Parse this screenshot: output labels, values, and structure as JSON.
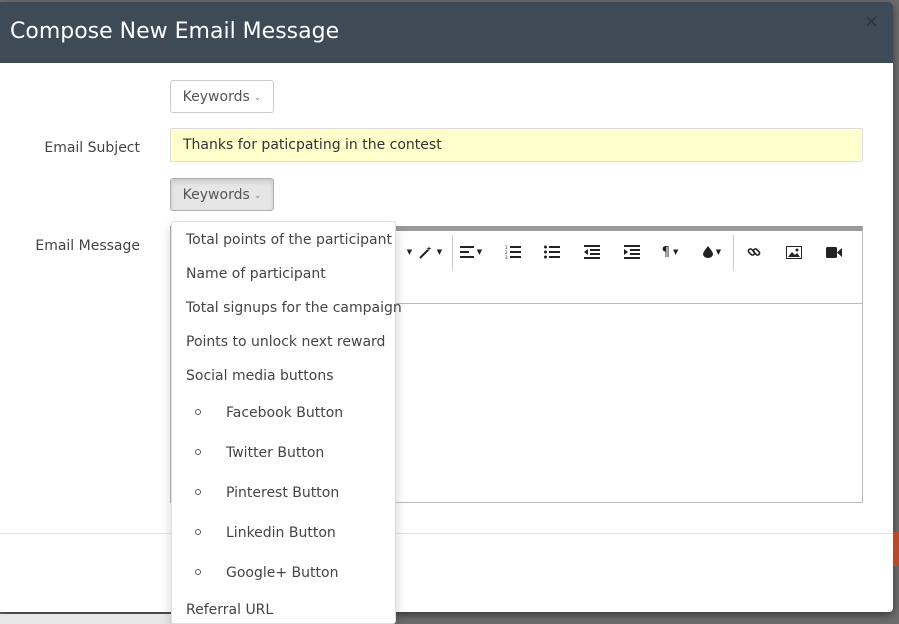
{
  "modal": {
    "title": "Compose New Email Message",
    "close_glyph": "×"
  },
  "keywords_top": {
    "label": "Keywords",
    "icon": "chevron-down-icon"
  },
  "subject": {
    "label": "Email Subject",
    "value": "Thanks for paticpating in the contest"
  },
  "keywords_message": {
    "label": "Keywords",
    "icon": "chevron-down-icon"
  },
  "message": {
    "label": "Email Message"
  },
  "toolbar": {
    "buttons": [
      "magic-wand",
      "align",
      "ordered-list",
      "unordered-list",
      "outdent",
      "indent",
      "paragraph",
      "color",
      "link",
      "image",
      "video"
    ]
  },
  "dropdown": {
    "items": [
      "Total points of the participant",
      "Name of participant",
      "Total signups for the campaign",
      "Points to unlock next reward",
      "Social media buttons"
    ],
    "sub_items": [
      "Facebook Button",
      "Twitter Button",
      "Pinterest Button",
      "Linkedin Button",
      "Google+ Button"
    ],
    "last_item": "Referral URL"
  },
  "colors": {
    "header_bg": "#3e4a56",
    "subject_bg": "#ffffcc",
    "accent": "#b44b2a"
  }
}
